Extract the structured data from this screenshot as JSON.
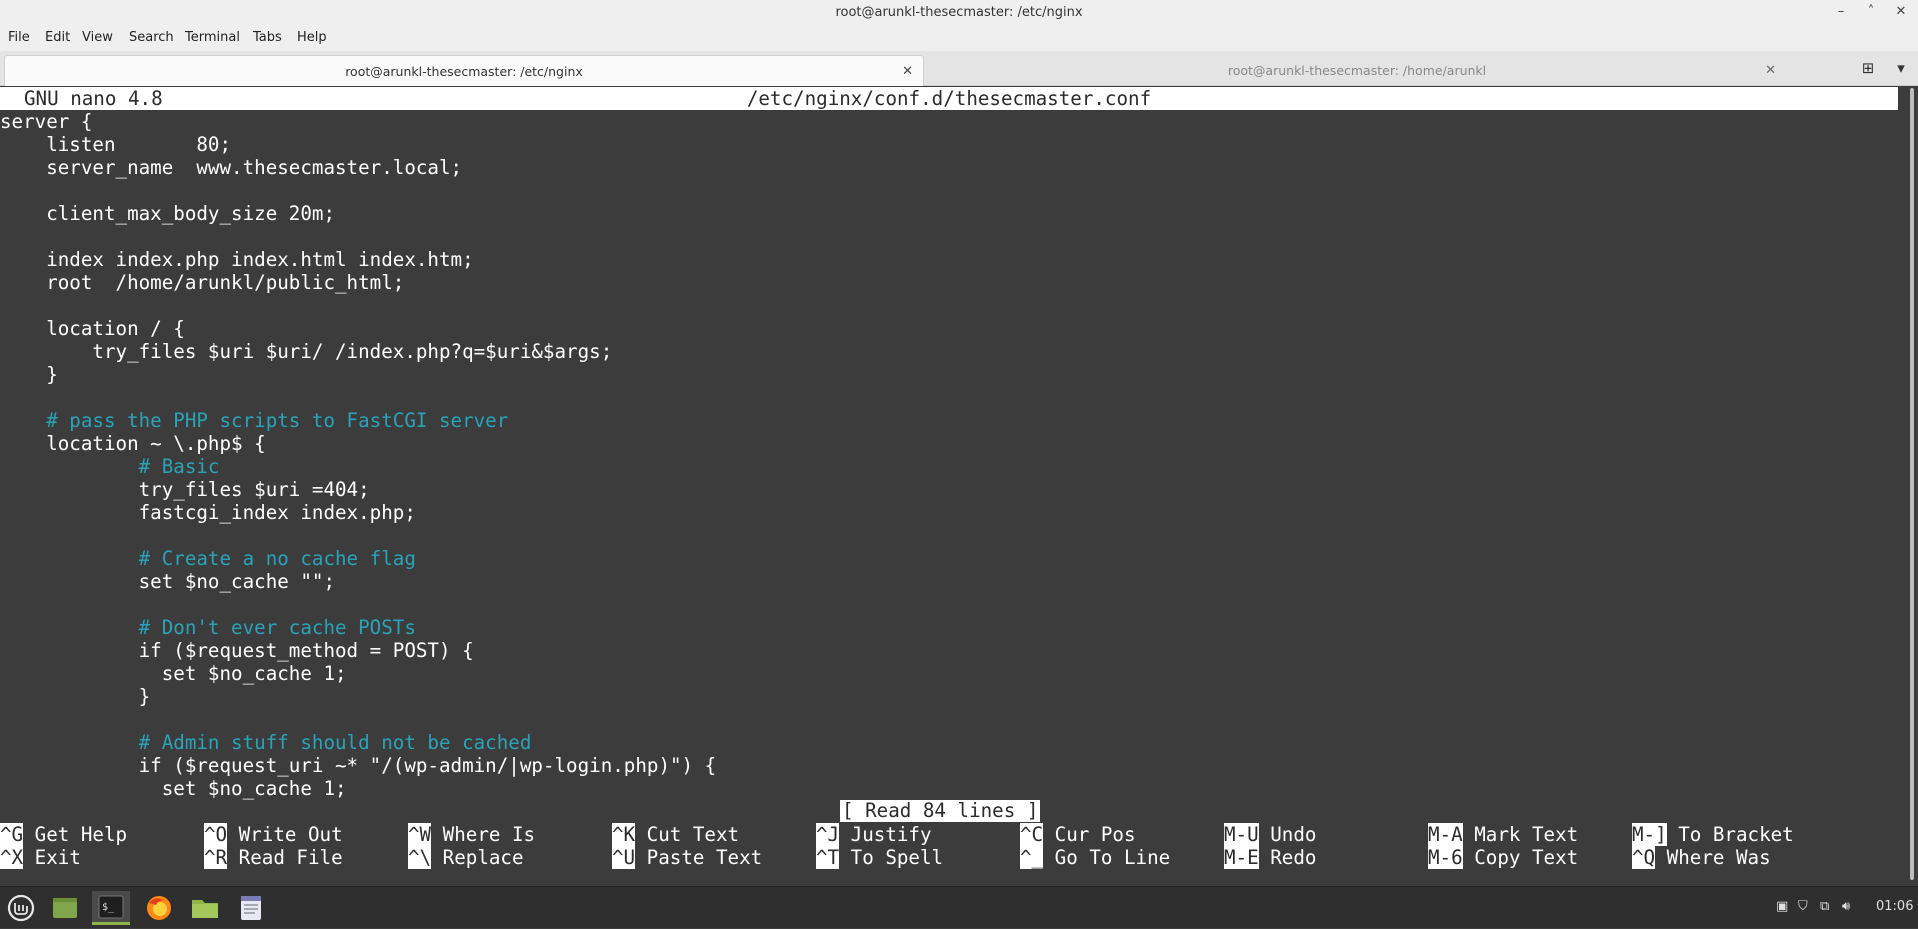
{
  "window": {
    "title": "root@arunkl-thesecmaster: /etc/nginx",
    "controls": [
      "minimize",
      "maximize",
      "close"
    ]
  },
  "menu": [
    "File",
    "Edit",
    "View",
    "Search",
    "Terminal",
    "Tabs",
    "Help"
  ],
  "tabs": [
    {
      "label": "root@arunkl-thesecmaster: /etc/nginx",
      "active": true
    },
    {
      "label": "root@arunkl-thesecmaster: /home/arunkl",
      "active": false
    }
  ],
  "nano": {
    "version": "GNU nano 4.8",
    "filename": "/etc/nginx/conf.d/thesecmaster.conf",
    "status_message": "[ Read 84 lines ]",
    "lines": [
      {
        "text": "server {",
        "comment": false
      },
      {
        "text": "    listen       80;",
        "comment": false
      },
      {
        "text": "    server_name  www.thesecmaster.local;",
        "comment": false
      },
      {
        "text": "",
        "comment": false
      },
      {
        "text": "    client_max_body_size 20m;",
        "comment": false
      },
      {
        "text": "",
        "comment": false
      },
      {
        "text": "    index index.php index.html index.htm;",
        "comment": false
      },
      {
        "text": "    root  /home/arunkl/public_html;",
        "comment": false
      },
      {
        "text": "",
        "comment": false
      },
      {
        "text": "    location / {",
        "comment": false
      },
      {
        "text": "        try_files $uri $uri/ /index.php?q=$uri&$args;",
        "comment": false
      },
      {
        "text": "    }",
        "comment": false
      },
      {
        "text": "",
        "comment": false
      },
      {
        "text": "    # pass the PHP scripts to FastCGI server",
        "comment": true
      },
      {
        "text": "    location ~ \\.php$ {",
        "comment": false
      },
      {
        "text": "            # Basic",
        "comment": true
      },
      {
        "text": "            try_files $uri =404;",
        "comment": false
      },
      {
        "text": "            fastcgi_index index.php;",
        "comment": false
      },
      {
        "text": "",
        "comment": false
      },
      {
        "text": "            # Create a no cache flag",
        "comment": true
      },
      {
        "text": "            set $no_cache \"\";",
        "comment": false
      },
      {
        "text": "",
        "comment": false
      },
      {
        "text": "            # Don't ever cache POSTs",
        "comment": true
      },
      {
        "text": "            if ($request_method = POST) {",
        "comment": false
      },
      {
        "text": "              set $no_cache 1;",
        "comment": false
      },
      {
        "text": "            }",
        "comment": false
      },
      {
        "text": "",
        "comment": false
      },
      {
        "text": "            # Admin stuff should not be cached",
        "comment": true
      },
      {
        "text": "            if ($request_uri ~* \"/(wp-admin/|wp-login.php)\") {",
        "comment": false
      },
      {
        "text": "              set $no_cache 1;",
        "comment": false
      }
    ],
    "shortcuts_row1": [
      {
        "key": "^G",
        "label": "Get Help"
      },
      {
        "key": "^O",
        "label": "Write Out"
      },
      {
        "key": "^W",
        "label": "Where Is"
      },
      {
        "key": "^K",
        "label": "Cut Text"
      },
      {
        "key": "^J",
        "label": "Justify"
      },
      {
        "key": "^C",
        "label": "Cur Pos"
      },
      {
        "key": "M-U",
        "label": "Undo"
      },
      {
        "key": "M-A",
        "label": "Mark Text"
      },
      {
        "key": "M-]",
        "label": "To Bracket"
      }
    ],
    "shortcuts_row2": [
      {
        "key": "^X",
        "label": "Exit"
      },
      {
        "key": "^R",
        "label": "Read File"
      },
      {
        "key": "^\\",
        "label": "Replace"
      },
      {
        "key": "^U",
        "label": "Paste Text"
      },
      {
        "key": "^T",
        "label": "To Spell"
      },
      {
        "key": "^_",
        "label": "Go To Line"
      },
      {
        "key": "M-E",
        "label": "Redo"
      },
      {
        "key": "M-6",
        "label": "Copy Text"
      },
      {
        "key": "^Q",
        "label": "Where Was"
      }
    ]
  },
  "taskbar": {
    "apps": [
      "menu",
      "show-desktop",
      "terminal",
      "firefox",
      "files",
      "text-editor"
    ],
    "clock": "01:06"
  }
}
